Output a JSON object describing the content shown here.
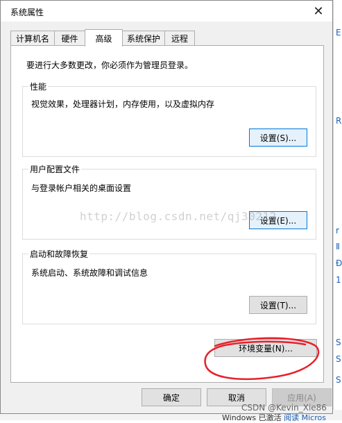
{
  "dialog": {
    "title": "系统属性",
    "close_glyph": "✕"
  },
  "tabs": [
    {
      "label": "计算机名"
    },
    {
      "label": "硬件"
    },
    {
      "label": "高级"
    },
    {
      "label": "系统保护"
    },
    {
      "label": "远程"
    }
  ],
  "active_tab": "高级",
  "intro": "要进行大多数更改，你必须作为管理员登录。",
  "performance": {
    "title": "性能",
    "description": "视觉效果，处理器计划，内存使用，以及虚拟内存",
    "button": "设置(S)..."
  },
  "user_profiles": {
    "title": "用户配置文件",
    "description": "与登录帐户相关的桌面设置",
    "button": "设置(E)..."
  },
  "startup_recovery": {
    "title": "启动和故障恢复",
    "description": "系统启动、系统故障和调试信息",
    "button": "设置(T)..."
  },
  "env_button": "环境变量(N)...",
  "footer": {
    "ok": "确定",
    "cancel": "取消",
    "apply": "应用(A)"
  },
  "watermark": "http://blog.csdn.net/qj30212",
  "csdn_credit": "CSDN @Kevin_Xie86",
  "background": {
    "right_fragments": [
      "E",
      "R",
      "r",
      "Ⅱ",
      "Ð",
      "1",
      "S",
      "S",
      "S"
    ],
    "windows_text": "Windows 已激活",
    "windows_link": "阅读 Micros"
  },
  "colors": {
    "annotation_red": "#e8202a",
    "focus_blue": "#0078d7"
  }
}
